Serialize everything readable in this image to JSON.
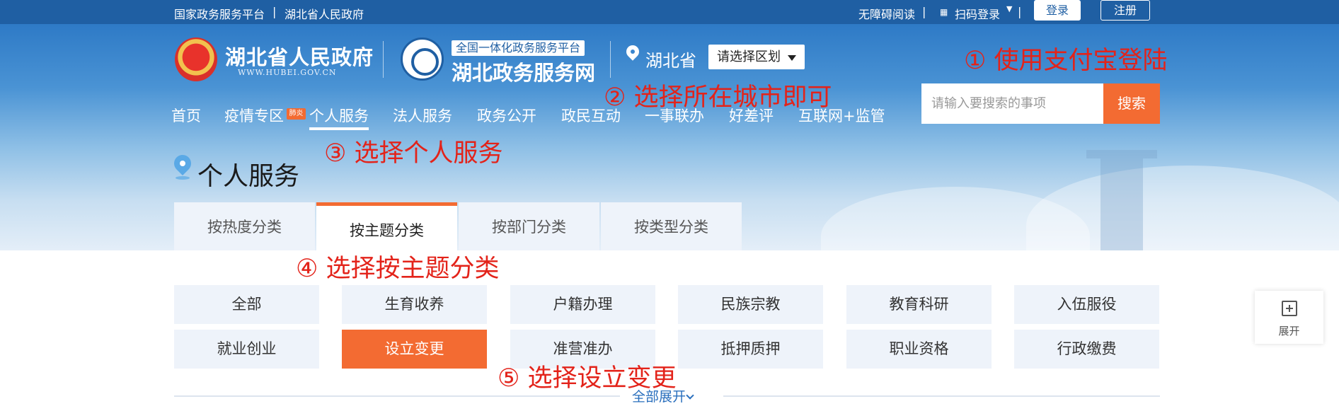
{
  "topbar": {
    "national_platform": "国家政务服务平台",
    "separator": "|",
    "hubei_gov": "湖北省人民政府",
    "accessibility": "无障碍阅读",
    "scan_login": "扫码登录",
    "login": "登录",
    "register": "注册"
  },
  "header": {
    "gov_title": "湖北省人民政府",
    "gov_domain": "WWW.HUBEI.GOV.CN",
    "platform_tag": "全国一体化政务服务平台",
    "service_name": "湖北政务服务网",
    "province": "湖北省",
    "region_select": "请选择区划",
    "search_placeholder": "请输入要搜索的事项",
    "search_button": "搜索"
  },
  "nav": {
    "items": [
      "首页",
      "疫情专区",
      "个人服务",
      "法人服务",
      "政务公开",
      "政民互动",
      "一事联办",
      "好差评",
      "互联网+监管"
    ],
    "hot_badge": "肺炎"
  },
  "page": {
    "title": "个人服务"
  },
  "tabs": [
    "按热度分类",
    "按主题分类",
    "按部门分类",
    "按类型分类"
  ],
  "categories": {
    "row1": [
      "全部",
      "生育收养",
      "户籍办理",
      "民族宗教",
      "教育科研",
      "入伍服役"
    ],
    "row2": [
      "就业创业",
      "设立变更",
      "准营准办",
      "抵押质押",
      "职业资格",
      "行政缴费"
    ]
  },
  "expand_all": "全部展开",
  "float_expand": "展开",
  "annotations": {
    "step1": "① 使用支付宝登陆",
    "step2": "② 选择所在城市即可",
    "step3": "③ 选择个人服务",
    "step4": "④ 选择按主题分类",
    "step5": "⑤ 选择设立变更"
  },
  "colors": {
    "primary_blue": "#1f5fa3",
    "accent_orange": "#f36b32",
    "annotation_red": "#e3231a",
    "category_bg": "#eef3fa"
  }
}
